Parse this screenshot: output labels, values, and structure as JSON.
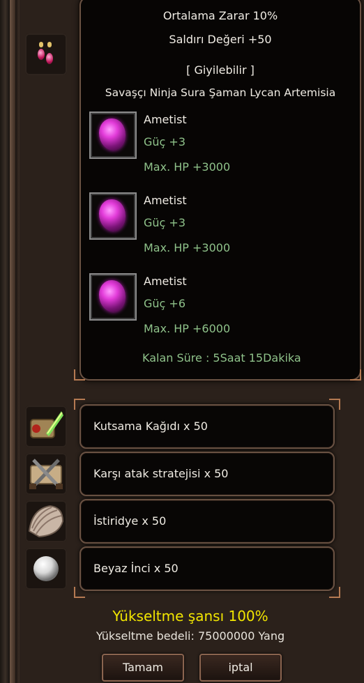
{
  "tooltip": {
    "avg_damage": "Ortalama Zarar 10%",
    "attack_value": "Saldırı Değeri +50",
    "wearable": "[ Giyilebilir ]",
    "classes": "Savaşçı Ninja Sura Şaman Lycan Artemisia",
    "bonuses": [
      {
        "name": "Ametist",
        "stat1": "Güç +3",
        "stat2": "Max. HP +3000"
      },
      {
        "name": "Ametist",
        "stat1": "Güç +3",
        "stat2": "Max. HP +3000"
      },
      {
        "name": "Ametist",
        "stat1": "Güç +6",
        "stat2": "Max. HP +6000"
      }
    ],
    "remaining_time": "Kalan Süre : 5Saat 15Dakika"
  },
  "item": {
    "icon": "earring-icon"
  },
  "materials": [
    {
      "label": "Kutsama Kağıdı x 50",
      "icon": "blessing-scroll-icon"
    },
    {
      "label": "Karşı atak stratejisi x 50",
      "icon": "crossed-swords-scroll-icon"
    },
    {
      "label": "İstiridye x 50",
      "icon": "oyster-shell-icon"
    },
    {
      "label": "Beyaz İnci x 50",
      "icon": "white-pearl-icon"
    }
  ],
  "upgrade": {
    "chance": "Yükseltme şansı 100%",
    "cost": "Yükseltme bedeli: 75000000 Yang"
  },
  "buttons": {
    "ok": "Tamam",
    "cancel": "iptal"
  },
  "colors": {
    "bonus_text": "#8fc28a",
    "chance_text": "#f2e600",
    "frame": "#6a5243",
    "panel": "#070504"
  }
}
